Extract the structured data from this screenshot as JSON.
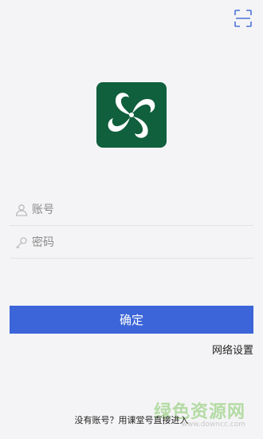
{
  "scan_icon": "scan-frame-icon",
  "logo_icon": "pinwheel-logo",
  "account": {
    "icon": "user-icon",
    "placeholder": "账号",
    "value": ""
  },
  "password": {
    "icon": "key-icon",
    "placeholder": "密码",
    "value": ""
  },
  "confirm_label": "确定",
  "network_settings_label": "网络设置",
  "no_account_label": "没有账号？用课堂号直接进入",
  "watermark": {
    "title": "绿色资源网",
    "url": "www.downcc.com"
  },
  "colors": {
    "background": "#f4f4f6",
    "logo": "#105f3d",
    "primary_button": "#3b65d8"
  }
}
